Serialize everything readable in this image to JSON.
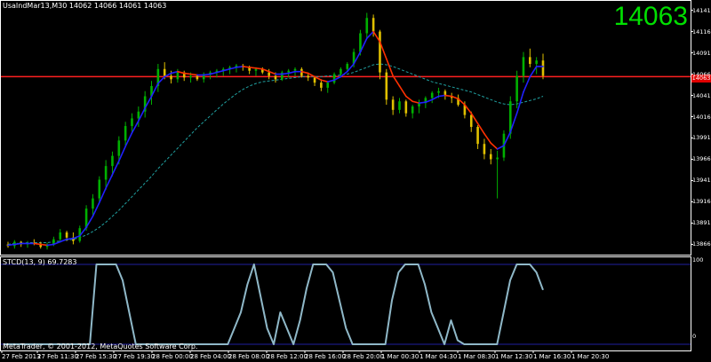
{
  "header": {
    "symbol_line": "UsaIndMar13,M30  14062 14066 14061 14063",
    "current_price_big": "14063",
    "current_price_tag": "14063"
  },
  "indicator": {
    "label": "STCD(13, 9) 69.7283",
    "ticks": [
      "100",
      "0"
    ]
  },
  "copyright": "MetaTrader, © 2001-2012, MetaQuotes Software Corp.",
  "colors": {
    "background": "#000000",
    "bull_candle": "#00b000",
    "bear_candle": "#e0c000",
    "ma_fast_up": "#2020ff",
    "ma_fast_down": "#ff3000",
    "ma_slow": "#20a0a0",
    "level_line": "#ff2020",
    "stc_line": "#8fb8c8",
    "frame": "#ffffff"
  },
  "chart_data": {
    "type": "line",
    "price_axis": {
      "ticks": [
        "14141",
        "14116",
        "14091",
        "14066",
        "14041",
        "14016",
        "13991",
        "13966",
        "13941",
        "13916",
        "13891",
        "13866"
      ],
      "range": [
        13856,
        14151
      ]
    },
    "time_axis": {
      "ticks": [
        "27 Feb 2013",
        "27 Feb 11:30",
        "27 Feb 15:30",
        "27 Feb 19:30",
        "28 Feb 00:00",
        "28 Feb 04:00",
        "28 Feb 08:00",
        "28 Feb 12:00",
        "28 Feb 16:00",
        "28 Feb 20:00",
        "1 Mar 00:30",
        "1 Mar 04:30",
        "1 Mar 08:30",
        "1 Mar 12:30",
        "1 Mar 16:30",
        "1 Mar 20:30"
      ]
    },
    "horizontal_level": 14063,
    "candles": [
      [
        13866,
        13869,
        13862,
        13864
      ],
      [
        13864,
        13871,
        13861,
        13869
      ],
      [
        13869,
        13870,
        13863,
        13866
      ],
      [
        13866,
        13870,
        13862,
        13868
      ],
      [
        13868,
        13872,
        13865,
        13867
      ],
      [
        13867,
        13869,
        13861,
        13863
      ],
      [
        13863,
        13868,
        13860,
        13866
      ],
      [
        13866,
        13875,
        13864,
        13872
      ],
      [
        13872,
        13884,
        13868,
        13880
      ],
      [
        13880,
        13882,
        13870,
        13874
      ],
      [
        13874,
        13880,
        13866,
        13870
      ],
      [
        13870,
        13888,
        13868,
        13885
      ],
      [
        13885,
        13912,
        13882,
        13908
      ],
      [
        13908,
        13925,
        13900,
        13920
      ],
      [
        13920,
        13946,
        13915,
        13942
      ],
      [
        13942,
        13965,
        13930,
        13958
      ],
      [
        13958,
        13975,
        13946,
        13970
      ],
      [
        13970,
        13993,
        13960,
        13988
      ],
      [
        13988,
        14010,
        13980,
        14005
      ],
      [
        14005,
        14020,
        13996,
        14014
      ],
      [
        14014,
        14028,
        14004,
        14022
      ],
      [
        14022,
        14046,
        14015,
        14040
      ],
      [
        14040,
        14058,
        14030,
        14052
      ],
      [
        14052,
        14078,
        14045,
        14072
      ],
      [
        14072,
        14080,
        14060,
        14064
      ],
      [
        14064,
        14070,
        14055,
        14060
      ],
      [
        14060,
        14072,
        14056,
        14068
      ],
      [
        14068,
        14070,
        14058,
        14062
      ],
      [
        14062,
        14068,
        14056,
        14064
      ],
      [
        14064,
        14066,
        14058,
        14060
      ],
      [
        14060,
        14068,
        14056,
        14066
      ],
      [
        14066,
        14070,
        14060,
        14068
      ],
      [
        14068,
        14072,
        14062,
        14070
      ],
      [
        14070,
        14074,
        14064,
        14072
      ],
      [
        14072,
        14076,
        14066,
        14074
      ],
      [
        14074,
        14078,
        14068,
        14076
      ],
      [
        14076,
        14078,
        14070,
        14074
      ],
      [
        14074,
        14076,
        14066,
        14070
      ],
      [
        14070,
        14074,
        14064,
        14072
      ],
      [
        14072,
        14074,
        14066,
        14068
      ],
      [
        14068,
        14072,
        14060,
        14064
      ],
      [
        14064,
        14068,
        14056,
        14060
      ],
      [
        14060,
        14070,
        14058,
        14068
      ],
      [
        14068,
        14072,
        14062,
        14070
      ],
      [
        14070,
        14074,
        14064,
        14072
      ],
      [
        14072,
        14074,
        14062,
        14064
      ],
      [
        14064,
        14068,
        14058,
        14062
      ],
      [
        14062,
        14064,
        14052,
        14056
      ],
      [
        14056,
        14060,
        14046,
        14050
      ],
      [
        14050,
        14058,
        14044,
        14056
      ],
      [
        14056,
        14068,
        14054,
        14066
      ],
      [
        14066,
        14074,
        14062,
        14072
      ],
      [
        14072,
        14080,
        14068,
        14078
      ],
      [
        14078,
        14096,
        14074,
        14092
      ],
      [
        14092,
        14118,
        14088,
        14114
      ],
      [
        14114,
        14138,
        14108,
        14132
      ],
      [
        14132,
        14136,
        14110,
        14116
      ],
      [
        14116,
        14118,
        14060,
        14068
      ],
      [
        14068,
        14072,
        14030,
        14036
      ],
      [
        14036,
        14040,
        14018,
        14024
      ],
      [
        14024,
        14038,
        14020,
        14034
      ],
      [
        14034,
        14036,
        14016,
        14020
      ],
      [
        14020,
        14030,
        14014,
        14028
      ],
      [
        14028,
        14036,
        14020,
        14032
      ],
      [
        14032,
        14040,
        14026,
        14038
      ],
      [
        14038,
        14046,
        14032,
        14044
      ],
      [
        14044,
        14050,
        14038,
        14046
      ],
      [
        14046,
        14048,
        14036,
        14040
      ],
      [
        14040,
        14044,
        14032,
        14038
      ],
      [
        14038,
        14042,
        14028,
        14030
      ],
      [
        14030,
        14034,
        14014,
        14018
      ],
      [
        14018,
        14022,
        13998,
        14004
      ],
      [
        14004,
        14006,
        13978,
        13984
      ],
      [
        13984,
        13990,
        13966,
        13972
      ],
      [
        13972,
        13978,
        13960,
        13966
      ],
      [
        13966,
        13976,
        13920,
        13968
      ],
      [
        13968,
        14000,
        13964,
        13996
      ],
      [
        13996,
        14040,
        13990,
        14034
      ],
      [
        14034,
        14070,
        14026,
        14064
      ],
      [
        14064,
        14092,
        14056,
        14086
      ],
      [
        14086,
        14096,
        14074,
        14078
      ],
      [
        14078,
        14086,
        14066,
        14082
      ],
      [
        14082,
        14090,
        14060,
        14064
      ]
    ],
    "ma_slow": [
      13866,
      13867,
      13867,
      13868,
      13868,
      13868,
      13868,
      13869,
      13870,
      13871,
      13872,
      13874,
      13877,
      13881,
      13886,
      13892,
      13899,
      13906,
      13914,
      13922,
      13930,
      13938,
      13946,
      13955,
      13963,
      13971,
      13979,
      13987,
      13995,
      14003,
      14010,
      14017,
      14024,
      14031,
      14037,
      14043,
      14048,
      14052,
      14055,
      14057,
      14058,
      14059,
      14060,
      14061,
      14062,
      14063,
      14063,
      14063,
      14063,
      14064,
      14064,
      14065,
      14066,
      14068,
      14071,
      14074,
      14077,
      14078,
      14077,
      14075,
      14072,
      14069,
      14066,
      14063,
      14060,
      14057,
      14055,
      14053,
      14051,
      14049,
      14047,
      14045,
      14042,
      14039,
      14036,
      14033,
      14031,
      14030,
      14031,
      14033,
      14035,
      14037,
      14040
    ],
    "ma_fast": [
      13865,
      13866,
      13867,
      13867,
      13867,
      13866,
      13865,
      13866,
      13869,
      13872,
      13873,
      13876,
      13886,
      13899,
      13915,
      13932,
      13948,
      13964,
      13981,
      13997,
      14011,
      14026,
      14040,
      14055,
      14063,
      14067,
      14069,
      14067,
      14066,
      14065,
      14065,
      14066,
      14068,
      14070,
      14072,
      14074,
      14075,
      14074,
      14073,
      14072,
      14069,
      14066,
      14066,
      14067,
      14069,
      14069,
      14067,
      14063,
      14059,
      14057,
      14059,
      14063,
      14069,
      14078,
      14092,
      14108,
      14116,
      14104,
      14084,
      14064,
      14052,
      14040,
      14034,
      14032,
      14033,
      14036,
      14040,
      14041,
      14040,
      14037,
      14030,
      14020,
      14008,
      13996,
      13985,
      13978,
      13982,
      13998,
      14020,
      14045,
      14063,
      14075,
      14075
    ],
    "stc": [
      0,
      0,
      0,
      0,
      0,
      0,
      0,
      0,
      0,
      0,
      0,
      0,
      0,
      0,
      100,
      100,
      100,
      100,
      80,
      40,
      0,
      0,
      0,
      0,
      0,
      0,
      0,
      0,
      0,
      0,
      0,
      0,
      0,
      0,
      0,
      20,
      40,
      75,
      100,
      60,
      20,
      0,
      40,
      20,
      0,
      30,
      70,
      100,
      100,
      100,
      90,
      55,
      20,
      0,
      0,
      0,
      0,
      0,
      0,
      55,
      90,
      100,
      100,
      100,
      75,
      40,
      20,
      0,
      30,
      5,
      0,
      0,
      0,
      0,
      0,
      0,
      40,
      80,
      100,
      100,
      100,
      90,
      68
    ]
  }
}
